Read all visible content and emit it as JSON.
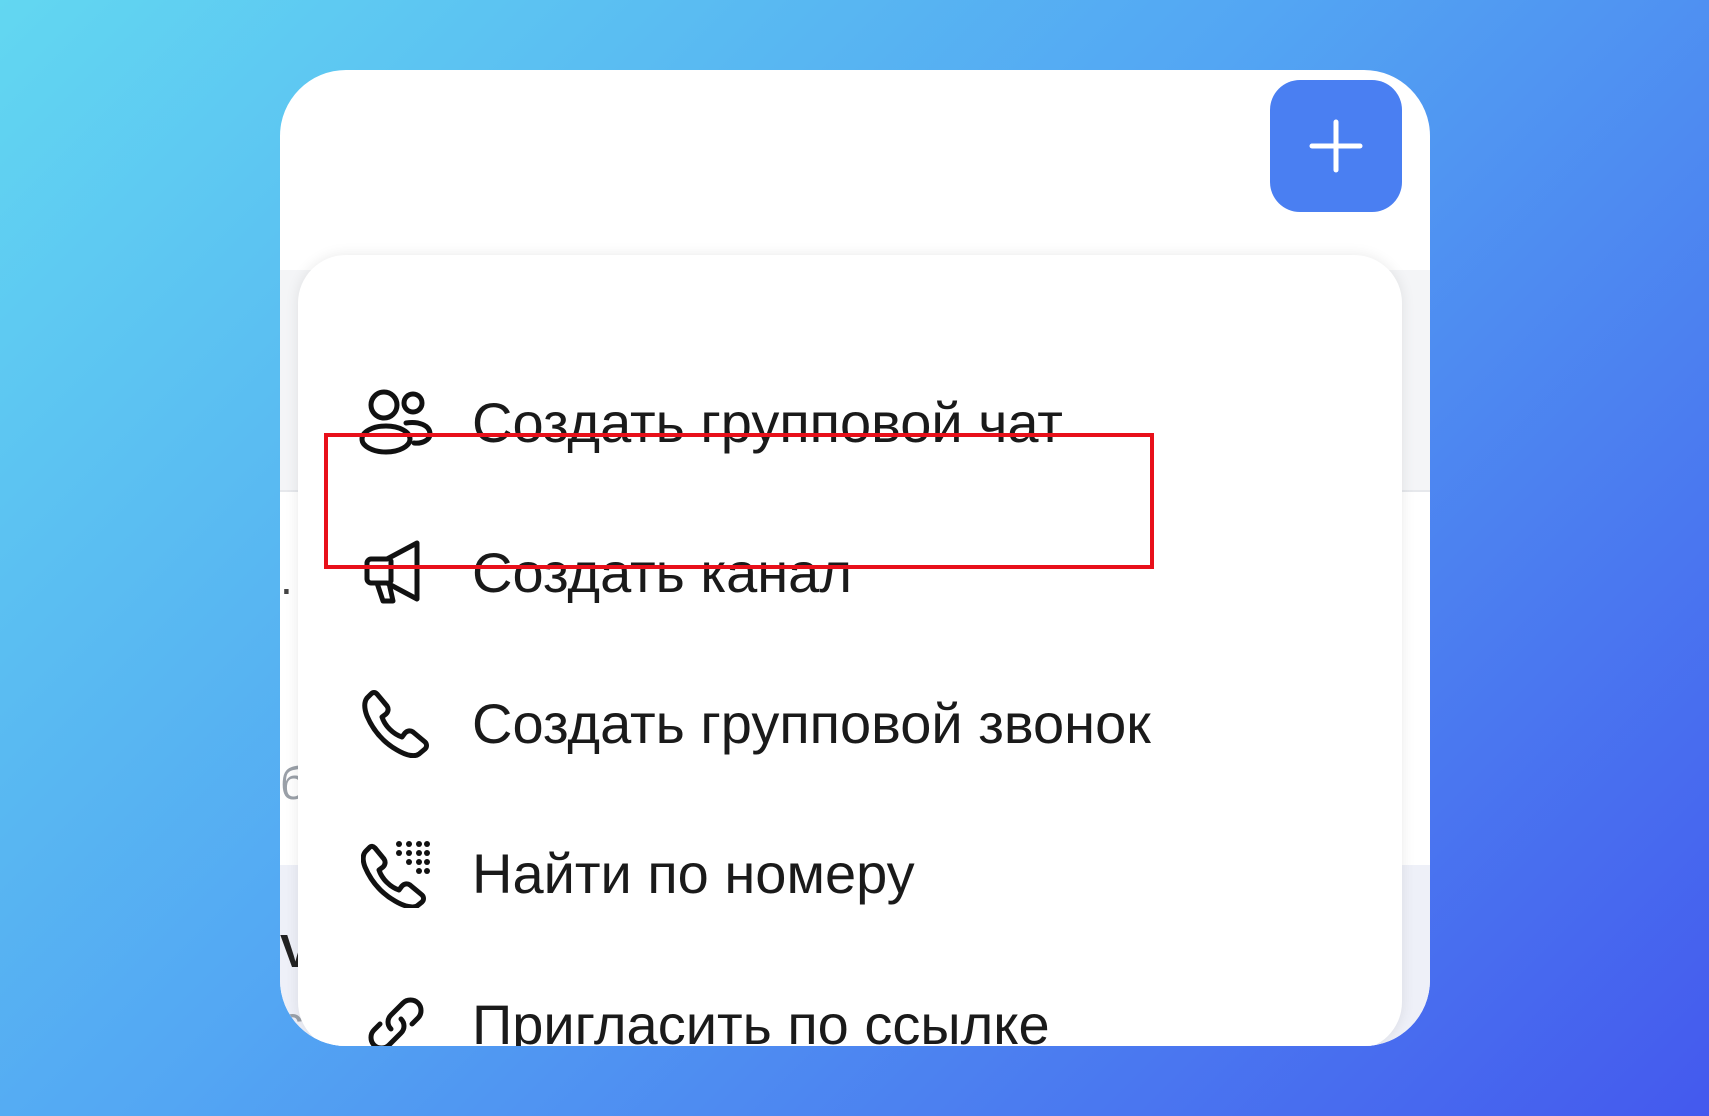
{
  "app": {
    "add_button": {
      "icon": "plus-icon",
      "color": "#4a7ff2"
    }
  },
  "menu": {
    "items": [
      {
        "label": "Создать групповой чат",
        "icon": "group-users-icon"
      },
      {
        "label": "Создать канал",
        "icon": "megaphone-icon",
        "highlighted": true
      },
      {
        "label": "Создать групповой звонок",
        "icon": "phone-icon"
      },
      {
        "label": "Найти по номеру",
        "icon": "phone-keypad-icon"
      },
      {
        "label": "Пригласить по ссылке",
        "icon": "link-icon"
      }
    ]
  },
  "background_fragments": {
    "glyphs": [
      ".",
      "б",
      "V",
      "с"
    ]
  },
  "colors": {
    "highlight_border": "#e8101a",
    "text": "#1a1a1a"
  }
}
